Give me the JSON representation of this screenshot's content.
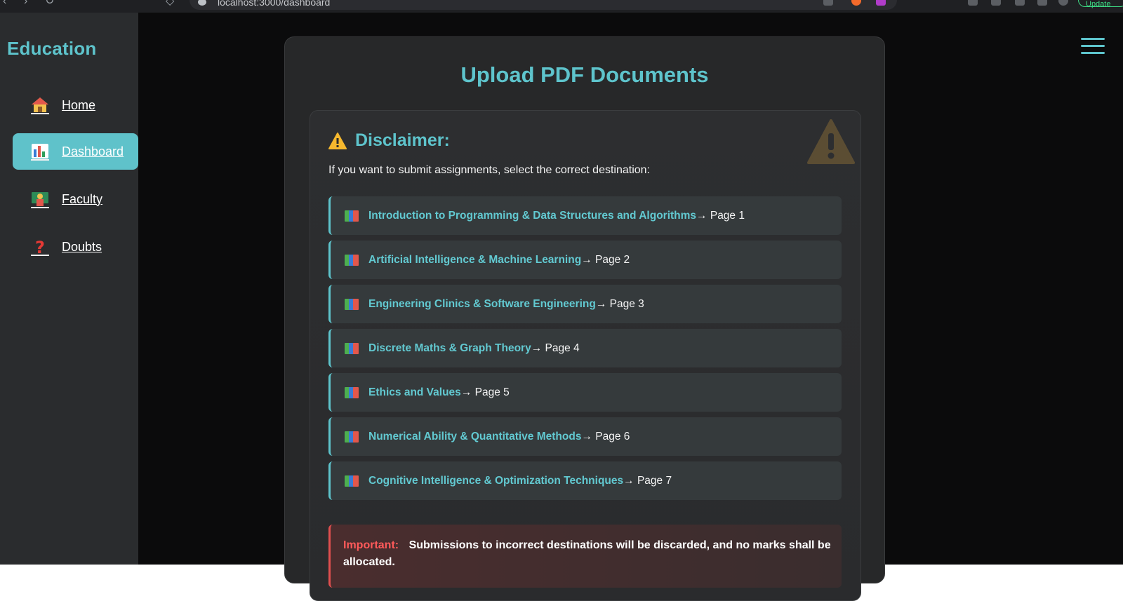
{
  "browser": {
    "url": "localhost:3000/dashboard",
    "update_label": "Update"
  },
  "sidebar": {
    "brand": "Education",
    "items": [
      {
        "label": "Home",
        "icon": "house-icon"
      },
      {
        "label": "Dashboard",
        "icon": "bar-chart-icon",
        "active": true
      },
      {
        "label": "Faculty",
        "icon": "teacher-icon"
      },
      {
        "label": "Doubts",
        "icon": "question-mark-icon"
      }
    ]
  },
  "header": {
    "menu_icon": "hamburger-menu-icon"
  },
  "main": {
    "title": "Upload PDF Documents",
    "disclaimer": {
      "title": "Disclaimer:",
      "text": "If you want to submit assignments, select the correct destination:",
      "courses": [
        {
          "name": "Introduction to Programming & Data Structures and Algorithms",
          "page": "→ Page 1"
        },
        {
          "name": "Artificial Intelligence & Machine Learning",
          "page": "→ Page 2"
        },
        {
          "name": "Engineering Clinics & Software Engineering",
          "page": "→ Page 3"
        },
        {
          "name": "Discrete Maths & Graph Theory",
          "page": "→ Page 4"
        },
        {
          "name": "Ethics and Values",
          "page": "→ Page 5"
        },
        {
          "name": "Numerical Ability & Quantitative Methods",
          "page": "→ Page 6"
        },
        {
          "name": "Cognitive Intelligence & Optimization Techniques",
          "page": "→ Page 7"
        }
      ],
      "important_label": "Important:",
      "important_text": "Submissions to incorrect destinations will be discarded, and no marks shall be allocated."
    }
  },
  "colors": {
    "accent": "#5ec4cc",
    "sidebar_bg": "#2a2c2e",
    "page_bg": "#0b0b0c",
    "danger": "#ff5a5a"
  }
}
